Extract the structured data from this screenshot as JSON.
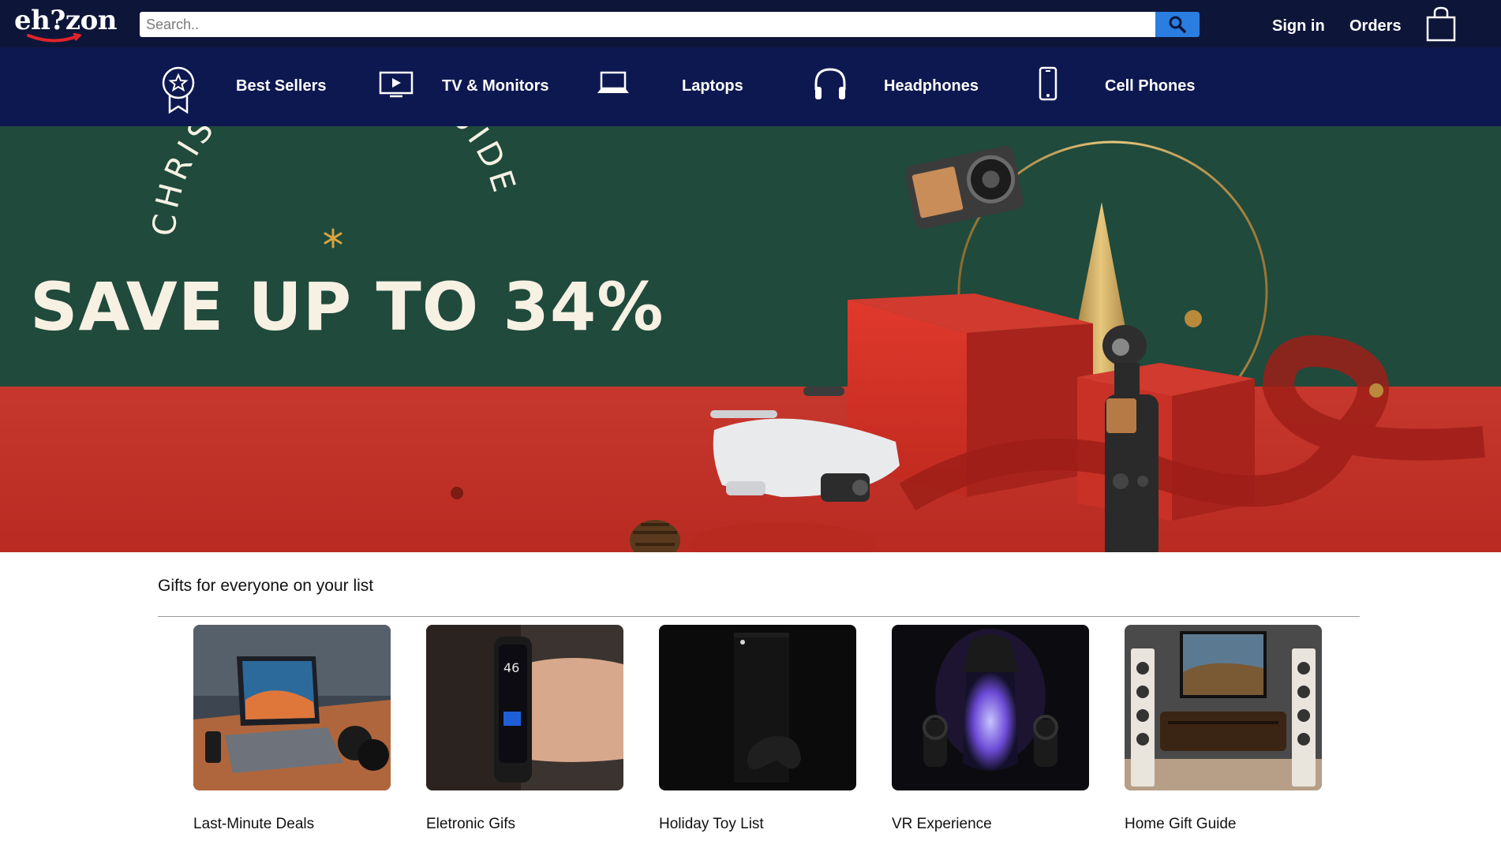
{
  "header": {
    "logo_text": "eh?zon",
    "search": {
      "placeholder": "Search..",
      "value": ""
    },
    "links": [
      "Sign in",
      "Orders"
    ],
    "cart_icon": "shopping-bag-icon"
  },
  "categories": [
    {
      "label": "Best Sellers",
      "icon": "award-ribbon-icon"
    },
    {
      "label": "TV & Monitors",
      "icon": "tv-icon"
    },
    {
      "label": "Laptops",
      "icon": "laptop-icon"
    },
    {
      "label": "Headphones",
      "icon": "headphones-icon"
    },
    {
      "label": "Cell Phones",
      "icon": "cell-phone-icon"
    }
  ],
  "hero": {
    "arc_text": "CHRISTMAS GIFT GUIDE",
    "headline": "SAVE UP TO 34%"
  },
  "gifts": {
    "title": "Gifts for everyone on your list",
    "items": [
      {
        "label": "Last-Minute Deals"
      },
      {
        "label": "Eletronic Gifs"
      },
      {
        "label": "Holiday Toy List"
      },
      {
        "label": "VR Experience"
      },
      {
        "label": "Home Gift Guide"
      }
    ]
  },
  "colors": {
    "header_bg": "#0d1638",
    "nav_bg": "#0e1850",
    "search_button": "#2a7de1",
    "hero_green": "#1f4a3c",
    "hero_red": "#c6372d",
    "headline_text": "#f7f1e3"
  }
}
